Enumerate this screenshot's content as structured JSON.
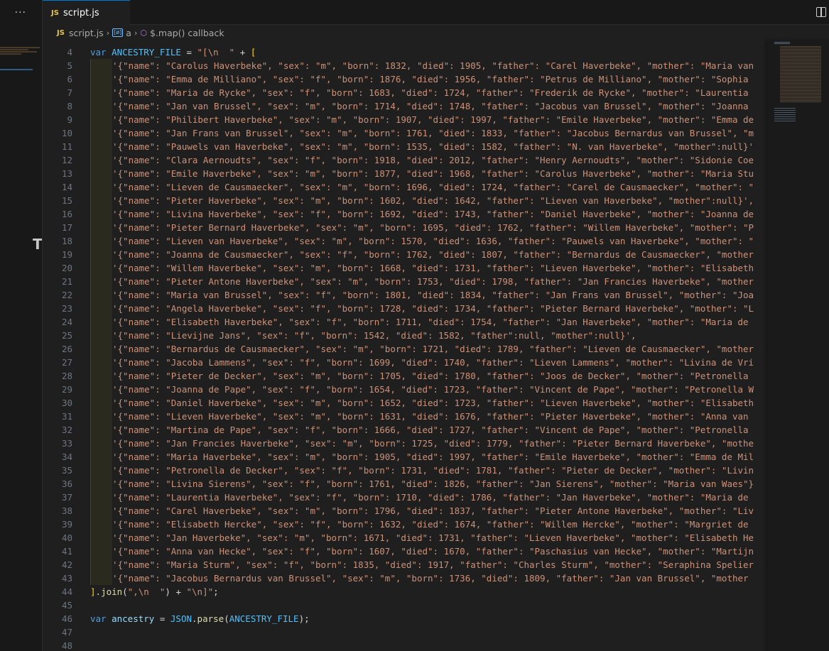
{
  "window": {
    "more_label": "···"
  },
  "tabs": [
    {
      "icon": "JS",
      "label": "script.js"
    }
  ],
  "breadcrumb": {
    "file_icon": "JS",
    "file": "script.js",
    "variable": "a",
    "callback": "$.map() callback"
  },
  "editor": {
    "lines": [
      {
        "n": "4",
        "guide": false,
        "tokens": [
          [
            "kw",
            "var "
          ],
          [
            "id",
            "ANCESTRY_FILE"
          ],
          [
            "pn",
            " = "
          ],
          [
            "st",
            "\"[\\n  \""
          ],
          [
            "pn",
            " + "
          ],
          [
            "br",
            "["
          ]
        ]
      },
      {
        "n": "5",
        "guide": true,
        "tokens": [
          [
            "st",
            "'{\"name\": \"Carolus Haverbeke\", \"sex\": \"m\", \"born\": 1832, \"died\": 1905, \"father\": \"Carel Haverbeke\", \"mother\": \"Maria van"
          ]
        ]
      },
      {
        "n": "6",
        "guide": true,
        "tokens": [
          [
            "st",
            "'{\"name\": \"Emma de Milliano\", \"sex\": \"f\", \"born\": 1876, \"died\": 1956, \"father\": \"Petrus de Milliano\", \"mother\": \"Sophia"
          ]
        ]
      },
      {
        "n": "7",
        "guide": true,
        "tokens": [
          [
            "st",
            "'{\"name\": \"Maria de Rycke\", \"sex\": \"f\", \"born\": 1683, \"died\": 1724, \"father\": \"Frederik de Rycke\", \"mother\": \"Laurentia"
          ]
        ]
      },
      {
        "n": "8",
        "guide": true,
        "tokens": [
          [
            "st",
            "'{\"name\": \"Jan van Brussel\", \"sex\": \"m\", \"born\": 1714, \"died\": 1748, \"father\": \"Jacobus van Brussel\", \"mother\": \"Joanna"
          ]
        ]
      },
      {
        "n": "9",
        "guide": true,
        "tokens": [
          [
            "st",
            "'{\"name\": \"Philibert Haverbeke\", \"sex\": \"m\", \"born\": 1907, \"died\": 1997, \"father\": \"Emile Haverbeke\", \"mother\": \"Emma de"
          ]
        ]
      },
      {
        "n": "10",
        "guide": true,
        "tokens": [
          [
            "st",
            "'{\"name\": \"Jan Frans van Brussel\", \"sex\": \"m\", \"born\": 1761, \"died\": 1833, \"father\": \"Jacobus Bernardus van Brussel\", \"m"
          ]
        ]
      },
      {
        "n": "11",
        "guide": true,
        "tokens": [
          [
            "st",
            "'{\"name\": \"Pauwels van Haverbeke\", \"sex\": \"m\", \"born\": 1535, \"died\": 1582, \"father\": \"N. van Haverbeke\", \"mother\":null}'"
          ]
        ]
      },
      {
        "n": "12",
        "guide": true,
        "tokens": [
          [
            "st",
            "'{\"name\": \"Clara Aernoudts\", \"sex\": \"f\", \"born\": 1918, \"died\": 2012, \"father\": \"Henry Aernoudts\", \"mother\": \"Sidonie Coe"
          ]
        ]
      },
      {
        "n": "13",
        "guide": true,
        "tokens": [
          [
            "st",
            "'{\"name\": \"Emile Haverbeke\", \"sex\": \"m\", \"born\": 1877, \"died\": 1968, \"father\": \"Carolus Haverbeke\", \"mother\": \"Maria Stu"
          ]
        ]
      },
      {
        "n": "14",
        "guide": true,
        "tokens": [
          [
            "st",
            "'{\"name\": \"Lieven de Causmaecker\", \"sex\": \"m\", \"born\": 1696, \"died\": 1724, \"father\": \"Carel de Causmaecker\", \"mother\": \""
          ]
        ]
      },
      {
        "n": "15",
        "guide": true,
        "tokens": [
          [
            "st",
            "'{\"name\": \"Pieter Haverbeke\", \"sex\": \"m\", \"born\": 1602, \"died\": 1642, \"father\": \"Lieven van Haverbeke\", \"mother\":null}',"
          ]
        ]
      },
      {
        "n": "16",
        "guide": true,
        "tokens": [
          [
            "st",
            "'{\"name\": \"Livina Haverbeke\", \"sex\": \"f\", \"born\": 1692, \"died\": 1743, \"father\": \"Daniel Haverbeke\", \"mother\": \"Joanna de"
          ]
        ]
      },
      {
        "n": "17",
        "guide": true,
        "tokens": [
          [
            "st",
            "'{\"name\": \"Pieter Bernard Haverbeke\", \"sex\": \"m\", \"born\": 1695, \"died\": 1762, \"father\": \"Willem Haverbeke\", \"mother\": \"P"
          ]
        ]
      },
      {
        "n": "18",
        "guide": true,
        "tokens": [
          [
            "st",
            "'{\"name\": \"Lieven van Haverbeke\", \"sex\": \"m\", \"born\": 1570, \"died\": 1636, \"father\": \"Pauwels van Haverbeke\", \"mother\": \""
          ]
        ]
      },
      {
        "n": "19",
        "guide": true,
        "tokens": [
          [
            "st",
            "'{\"name\": \"Joanna de Causmaecker\", \"sex\": \"f\", \"born\": 1762, \"died\": 1807, \"father\": \"Bernardus de Causmaecker\", \"mother"
          ]
        ]
      },
      {
        "n": "20",
        "guide": true,
        "tokens": [
          [
            "st",
            "'{\"name\": \"Willem Haverbeke\", \"sex\": \"m\", \"born\": 1668, \"died\": 1731, \"father\": \"Lieven Haverbeke\", \"mother\": \"Elisabeth"
          ]
        ]
      },
      {
        "n": "21",
        "guide": true,
        "tokens": [
          [
            "st",
            "'{\"name\": \"Pieter Antone Haverbeke\", \"sex\": \"m\", \"born\": 1753, \"died\": 1798, \"father\": \"Jan Francies Haverbeke\", \"mother"
          ]
        ]
      },
      {
        "n": "22",
        "guide": true,
        "tokens": [
          [
            "st",
            "'{\"name\": \"Maria van Brussel\", \"sex\": \"f\", \"born\": 1801, \"died\": 1834, \"father\": \"Jan Frans van Brussel\", \"mother\": \"Joa"
          ]
        ]
      },
      {
        "n": "23",
        "guide": true,
        "tokens": [
          [
            "st",
            "'{\"name\": \"Angela Haverbeke\", \"sex\": \"f\", \"born\": 1728, \"died\": 1734, \"father\": \"Pieter Bernard Haverbeke\", \"mother\": \"L"
          ]
        ]
      },
      {
        "n": "24",
        "guide": true,
        "tokens": [
          [
            "st",
            "'{\"name\": \"Elisabeth Haverbeke\", \"sex\": \"f\", \"born\": 1711, \"died\": 1754, \"father\": \"Jan Haverbeke\", \"mother\": \"Maria de"
          ]
        ]
      },
      {
        "n": "25",
        "guide": true,
        "tokens": [
          [
            "st",
            "'{\"name\": \"Lievijne Jans\", \"sex\": \"f\", \"born\": 1542, \"died\": 1582, \"father\":null, \"mother\":null}',"
          ]
        ]
      },
      {
        "n": "26",
        "guide": true,
        "tokens": [
          [
            "st",
            "'{\"name\": \"Bernardus de Causmaecker\", \"sex\": \"m\", \"born\": 1721, \"died\": 1789, \"father\": \"Lieven de Causmaecker\", \"mother"
          ]
        ]
      },
      {
        "n": "27",
        "guide": true,
        "tokens": [
          [
            "st",
            "'{\"name\": \"Jacoba Lammens\", \"sex\": \"f\", \"born\": 1699, \"died\": 1740, \"father\": \"Lieven Lammens\", \"mother\": \"Livina de Vri"
          ]
        ]
      },
      {
        "n": "28",
        "guide": true,
        "tokens": [
          [
            "st",
            "'{\"name\": \"Pieter de Decker\", \"sex\": \"m\", \"born\": 1705, \"died\": 1780, \"father\": \"Joos de Decker\", \"mother\": \"Petronella"
          ]
        ]
      },
      {
        "n": "29",
        "guide": true,
        "tokens": [
          [
            "st",
            "'{\"name\": \"Joanna de Pape\", \"sex\": \"f\", \"born\": 1654, \"died\": 1723, \"father\": \"Vincent de Pape\", \"mother\": \"Petronella W"
          ]
        ]
      },
      {
        "n": "30",
        "guide": true,
        "tokens": [
          [
            "st",
            "'{\"name\": \"Daniel Haverbeke\", \"sex\": \"m\", \"born\": 1652, \"died\": 1723, \"father\": \"Lieven Haverbeke\", \"mother\": \"Elisabeth"
          ]
        ]
      },
      {
        "n": "31",
        "guide": true,
        "tokens": [
          [
            "st",
            "'{\"name\": \"Lieven Haverbeke\", \"sex\": \"m\", \"born\": 1631, \"died\": 1676, \"father\": \"Pieter Haverbeke\", \"mother\": \"Anna van"
          ]
        ]
      },
      {
        "n": "32",
        "guide": true,
        "tokens": [
          [
            "st",
            "'{\"name\": \"Martina de Pape\", \"sex\": \"f\", \"born\": 1666, \"died\": 1727, \"father\": \"Vincent de Pape\", \"mother\": \"Petronella"
          ]
        ]
      },
      {
        "n": "33",
        "guide": true,
        "tokens": [
          [
            "st",
            "'{\"name\": \"Jan Francies Haverbeke\", \"sex\": \"m\", \"born\": 1725, \"died\": 1779, \"father\": \"Pieter Bernard Haverbeke\", \"mothe"
          ]
        ]
      },
      {
        "n": "34",
        "guide": true,
        "tokens": [
          [
            "st",
            "'{\"name\": \"Maria Haverbeke\", \"sex\": \"m\", \"born\": 1905, \"died\": 1997, \"father\": \"Emile Haverbeke\", \"mother\": \"Emma de Mil"
          ]
        ]
      },
      {
        "n": "35",
        "guide": true,
        "tokens": [
          [
            "st",
            "'{\"name\": \"Petronella de Decker\", \"sex\": \"f\", \"born\": 1731, \"died\": 1781, \"father\": \"Pieter de Decker\", \"mother\": \"Livin"
          ]
        ]
      },
      {
        "n": "36",
        "guide": true,
        "tokens": [
          [
            "st",
            "'{\"name\": \"Livina Sierens\", \"sex\": \"f\", \"born\": 1761, \"died\": 1826, \"father\": \"Jan Sierens\", \"mother\": \"Maria van Waes\"}"
          ]
        ]
      },
      {
        "n": "37",
        "guide": true,
        "tokens": [
          [
            "st",
            "'{\"name\": \"Laurentia Haverbeke\", \"sex\": \"f\", \"born\": 1710, \"died\": 1786, \"father\": \"Jan Haverbeke\", \"mother\": \"Maria de"
          ]
        ]
      },
      {
        "n": "38",
        "guide": true,
        "tokens": [
          [
            "st",
            "'{\"name\": \"Carel Haverbeke\", \"sex\": \"m\", \"born\": 1796, \"died\": 1837, \"father\": \"Pieter Antone Haverbeke\", \"mother\": \"Liv"
          ]
        ]
      },
      {
        "n": "39",
        "guide": true,
        "tokens": [
          [
            "st",
            "'{\"name\": \"Elisabeth Hercke\", \"sex\": \"f\", \"born\": 1632, \"died\": 1674, \"father\": \"Willem Hercke\", \"mother\": \"Margriet de"
          ]
        ]
      },
      {
        "n": "40",
        "guide": true,
        "tokens": [
          [
            "st",
            "'{\"name\": \"Jan Haverbeke\", \"sex\": \"m\", \"born\": 1671, \"died\": 1731, \"father\": \"Lieven Haverbeke\", \"mother\": \"Elisabeth He"
          ]
        ]
      },
      {
        "n": "41",
        "guide": true,
        "tokens": [
          [
            "st",
            "'{\"name\": \"Anna van Hecke\", \"sex\": \"f\", \"born\": 1607, \"died\": 1670, \"father\": \"Paschasius van Hecke\", \"mother\": \"Martijn"
          ]
        ]
      },
      {
        "n": "42",
        "guide": true,
        "tokens": [
          [
            "st",
            "'{\"name\": \"Maria Sturm\", \"sex\": \"f\", \"born\": 1835, \"died\": 1917, \"father\": \"Charles Sturm\", \"mother\": \"Seraphina Spelier"
          ]
        ]
      },
      {
        "n": "43",
        "guide": true,
        "tokens": [
          [
            "st",
            "'{\"name\": \"Jacobus Bernardus van Brussel\", \"sex\": \"m\", \"born\": 1736, \"died\": 1809, \"father\": \"Jan van Brussel\", \"mother"
          ]
        ]
      },
      {
        "n": "44",
        "guide": false,
        "tokens": [
          [
            "br",
            "]"
          ],
          [
            "pn",
            "."
          ],
          [
            "fn",
            "join"
          ],
          [
            "pn",
            "("
          ],
          [
            "st",
            "\",\\n  \""
          ],
          [
            "pn",
            ") + "
          ],
          [
            "st",
            "\"\\n]\""
          ],
          [
            "pn",
            ";"
          ]
        ]
      },
      {
        "n": "45",
        "guide": false,
        "tokens": []
      },
      {
        "n": "46",
        "guide": false,
        "tokens": [
          [
            "kw",
            "var "
          ],
          [
            "vr",
            "ancestry"
          ],
          [
            "pn",
            " = "
          ],
          [
            "id",
            "JSON"
          ],
          [
            "pn",
            "."
          ],
          [
            "fn",
            "parse"
          ],
          [
            "pn",
            "("
          ],
          [
            "id",
            "ANCESTRY_FILE"
          ],
          [
            "pn",
            ");"
          ]
        ]
      },
      {
        "n": "47",
        "guide": false,
        "tokens": []
      },
      {
        "n": "48",
        "guide": false,
        "tokens": []
      }
    ]
  },
  "left_panel": {
    "glyph": "T"
  }
}
